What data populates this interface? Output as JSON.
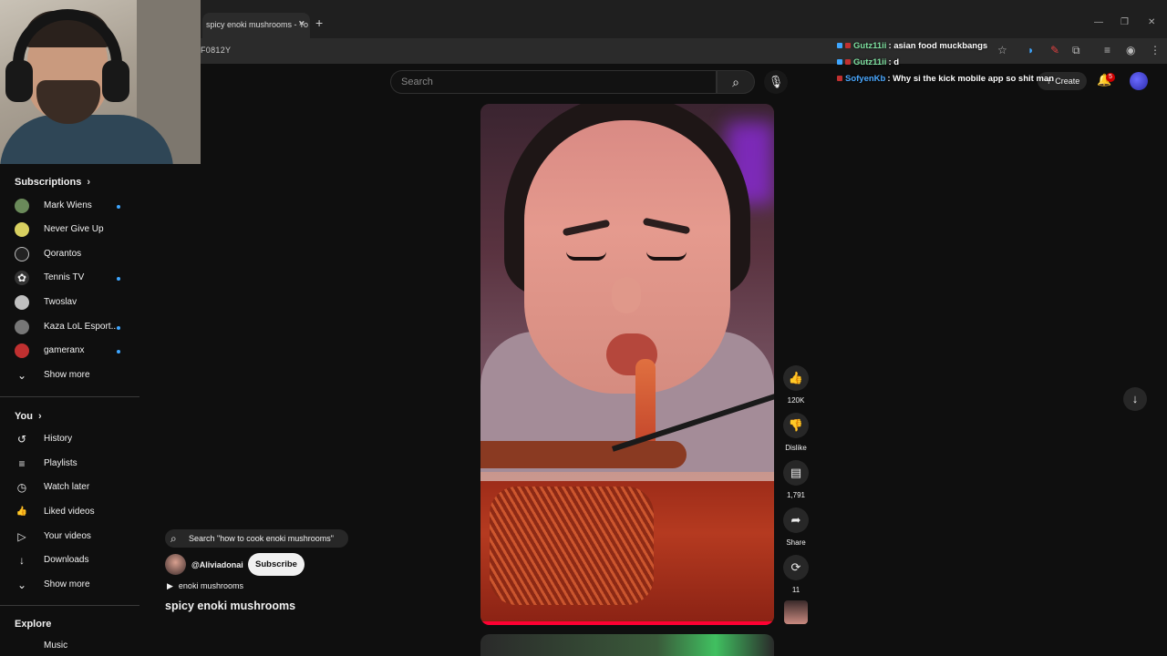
{
  "browser": {
    "tab_title": "spicy enoki mushrooms - Yo",
    "tab_close": "×",
    "new_tab": "+",
    "url_fragment": "F0812Y"
  },
  "search": {
    "placeholder": "Search"
  },
  "header": {
    "create_label": "Create",
    "notification_count": "5"
  },
  "chat": [
    {
      "name": "Gutz11ii",
      "message": ": asian food muckbangs",
      "name_color": "#7ee0a0"
    },
    {
      "name": "Gutz11ii",
      "message": ": d",
      "name_color": "#7ee0a0"
    },
    {
      "name": "SofyenKb",
      "message": ": Why si the kick mobile app so shit man",
      "name_color": "#4aa8ff"
    }
  ],
  "sidebar": {
    "subscriptions_title": "Subscriptions",
    "subscriptions": [
      {
        "label": "Mark Wiens",
        "dot": true,
        "icon_color": "#6a8a5a"
      },
      {
        "label": "Never Give Up",
        "dot": false,
        "icon_color": "#d8d060"
      },
      {
        "label": "Qorantos",
        "dot": false,
        "icon_color": "#222222"
      },
      {
        "label": "Tennis TV",
        "dot": true,
        "icon_color": "#333333"
      },
      {
        "label": "Twoslav",
        "dot": false,
        "icon_color": "#c0c0c0"
      },
      {
        "label": "Kaza LoL Esport...",
        "dot": true,
        "icon_color": "#777777"
      },
      {
        "label": "gameranx",
        "dot": true,
        "icon_color": "#c03030"
      }
    ],
    "show_more_1": "Show more",
    "you_title": "You",
    "you_items": [
      {
        "label": "History",
        "icon": "↺"
      },
      {
        "label": "Playlists",
        "icon": "≡"
      },
      {
        "label": "Watch later",
        "icon": "◷"
      },
      {
        "label": "Liked videos",
        "icon": "👍"
      },
      {
        "label": "Your videos",
        "icon": "▷"
      },
      {
        "label": "Downloads",
        "icon": "↓"
      }
    ],
    "show_more_2": "Show more",
    "explore_title": "Explore",
    "explore_partial": "Music"
  },
  "actions": {
    "like_count": "120K",
    "dislike_label": "Dislike",
    "comment_count": "1,791",
    "share_label": "Share",
    "remix_count": "11"
  },
  "video_meta": {
    "search_suggestion": "Search \"how to cook enoki mushrooms\"",
    "channel_handle": "@Aliviadonai",
    "subscribe_label": "Subscribe",
    "playlist_label": "enoki mushrooms",
    "title": "spicy enoki mushrooms"
  },
  "colors": {
    "accent_blue": "#3ea6ff",
    "youtube_red": "#ff0033",
    "background": "#0f0f0f"
  }
}
